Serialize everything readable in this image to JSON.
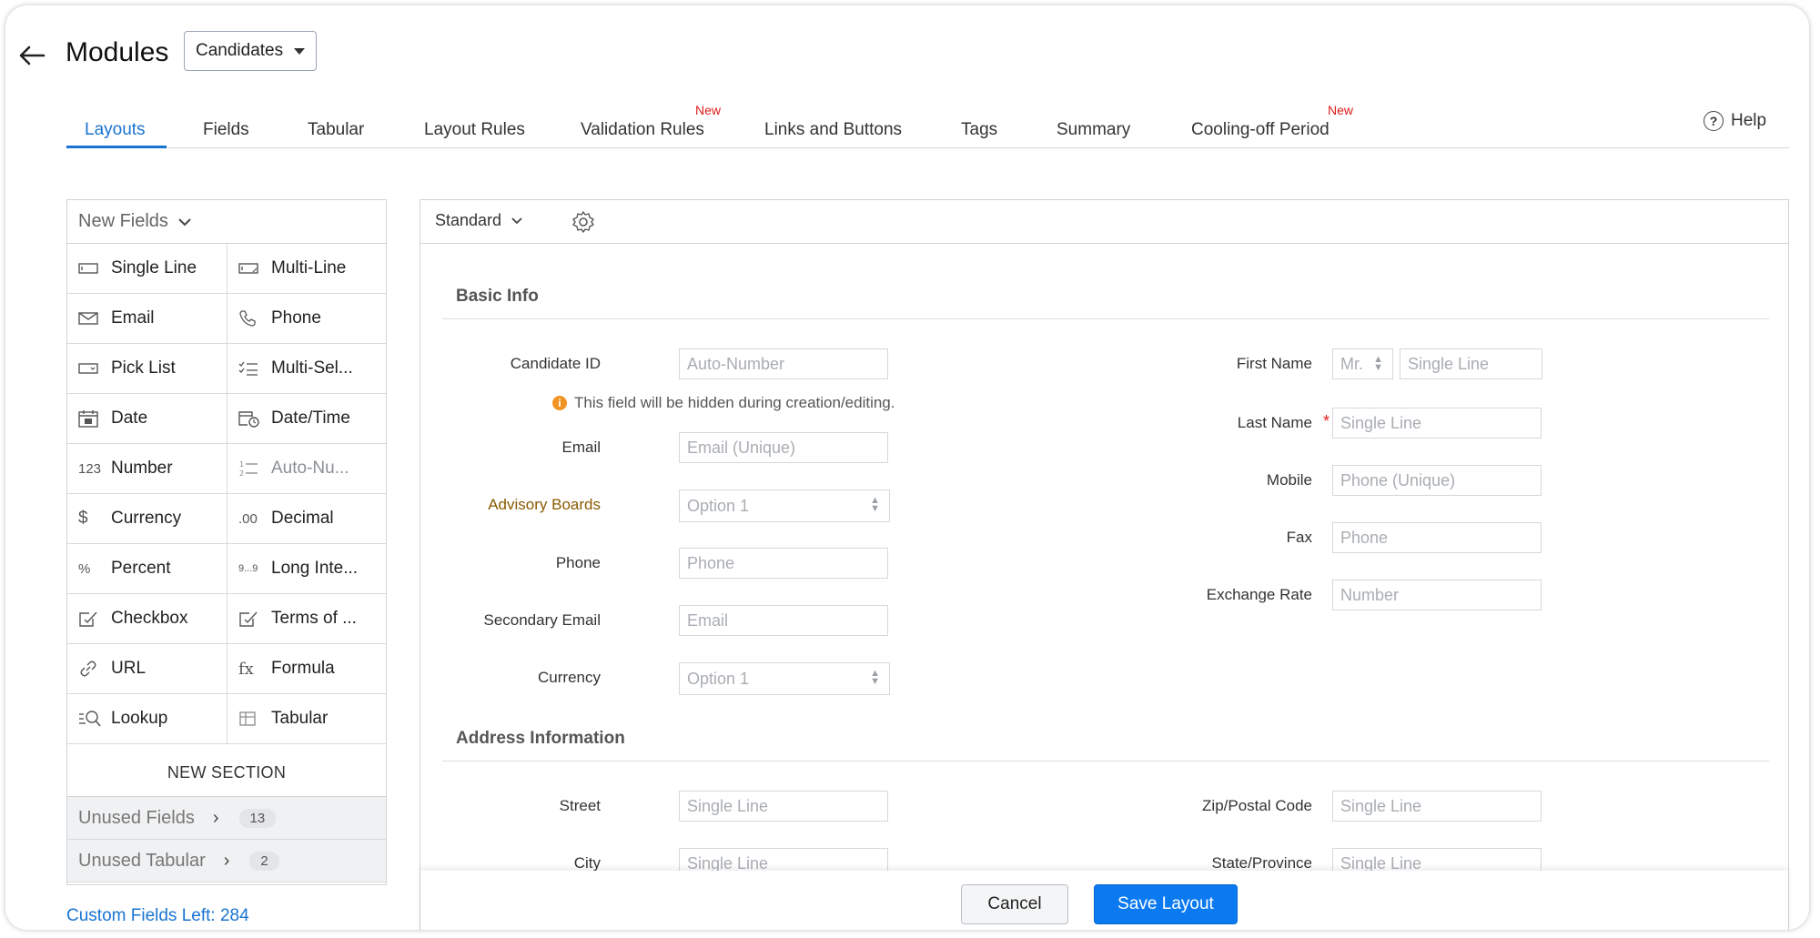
{
  "header": {
    "title": "Modules",
    "module_select": "Candidates",
    "help_label": "Help"
  },
  "tabs": [
    {
      "label": "Layouts",
      "active": true,
      "new": false
    },
    {
      "label": "Fields",
      "new": false
    },
    {
      "label": "Tabular",
      "new": false
    },
    {
      "label": "Layout Rules",
      "new": false
    },
    {
      "label": "Validation Rules",
      "new": true
    },
    {
      "label": "Links and Buttons",
      "new": false
    },
    {
      "label": "Tags",
      "new": false
    },
    {
      "label": "Summary",
      "new": false
    },
    {
      "label": "Cooling-off Period",
      "new": true
    }
  ],
  "new_badge": "New",
  "left_panel": {
    "header": "New Fields",
    "fields": [
      {
        "label": "Single Line",
        "icon": "single-line-icon"
      },
      {
        "label": "Multi-Line",
        "icon": "multi-line-icon"
      },
      {
        "label": "Email",
        "icon": "email-icon"
      },
      {
        "label": "Phone",
        "icon": "phone-icon"
      },
      {
        "label": "Pick List",
        "icon": "pick-list-icon"
      },
      {
        "label": "Multi-Sel...",
        "icon": "multi-select-icon"
      },
      {
        "label": "Date",
        "icon": "date-icon"
      },
      {
        "label": "Date/Time",
        "icon": "date-time-icon"
      },
      {
        "label": "Number",
        "icon": "number-icon",
        "glyph": "123"
      },
      {
        "label": "Auto-Nu...",
        "icon": "auto-number-icon",
        "dim": true
      },
      {
        "label": "Currency",
        "icon": "currency-icon",
        "glyph": "$"
      },
      {
        "label": "Decimal",
        "icon": "decimal-icon",
        "glyph": ".00"
      },
      {
        "label": "Percent",
        "icon": "percent-icon",
        "glyph": "%"
      },
      {
        "label": "Long Inte...",
        "icon": "long-integer-icon",
        "glyph": "9...9"
      },
      {
        "label": "Checkbox",
        "icon": "checkbox-icon"
      },
      {
        "label": "Terms of ...",
        "icon": "terms-icon"
      },
      {
        "label": "URL",
        "icon": "url-icon"
      },
      {
        "label": "Formula",
        "icon": "formula-icon",
        "glyph": "fx"
      },
      {
        "label": "Lookup",
        "icon": "lookup-icon"
      },
      {
        "label": "Tabular",
        "icon": "tabular-icon"
      }
    ],
    "new_section": "NEW SECTION",
    "unused_fields": {
      "label": "Unused Fields",
      "count": "13"
    },
    "unused_tabular": {
      "label": "Unused Tabular",
      "count": "2"
    },
    "custom_fields_left": "Custom Fields Left: 284"
  },
  "layout": {
    "name": "Standard",
    "sections": [
      {
        "title": "Basic Info"
      },
      {
        "title": "Address Information"
      }
    ],
    "hidden_note": "This field will be hidden during creation/editing.",
    "basic_left": [
      {
        "label": "Candidate ID",
        "placeholder": "Auto-Number"
      },
      {
        "label": "Email",
        "placeholder": "Email (Unique)"
      },
      {
        "label": "Advisory Boards",
        "placeholder": "Option 1"
      },
      {
        "label": "Phone",
        "placeholder": "Phone"
      },
      {
        "label": "Secondary Email",
        "placeholder": "Email"
      },
      {
        "label": "Currency",
        "placeholder": "Option 1"
      }
    ],
    "basic_right": [
      {
        "label": "First Name",
        "salutation": "Mr.",
        "placeholder": "Single Line"
      },
      {
        "label": "Last Name",
        "placeholder": "Single Line",
        "required": "*"
      },
      {
        "label": "Mobile",
        "placeholder": "Phone (Unique)"
      },
      {
        "label": "Fax",
        "placeholder": "Phone"
      },
      {
        "label": "Exchange Rate",
        "placeholder": "Number"
      }
    ],
    "address_left": [
      {
        "label": "Street",
        "placeholder": "Single Line"
      },
      {
        "label": "City",
        "placeholder": "Single Line"
      }
    ],
    "address_right": [
      {
        "label": "Zip/Postal Code",
        "placeholder": "Single Line"
      },
      {
        "label": "State/Province",
        "placeholder": "Single Line"
      }
    ]
  },
  "footer": {
    "cancel": "Cancel",
    "save": "Save Layout"
  },
  "colors": {
    "accent": "#1a73d1",
    "primary_button": "#0b79f0",
    "new_badge": "#e01b1b",
    "warning": "#f29423"
  }
}
